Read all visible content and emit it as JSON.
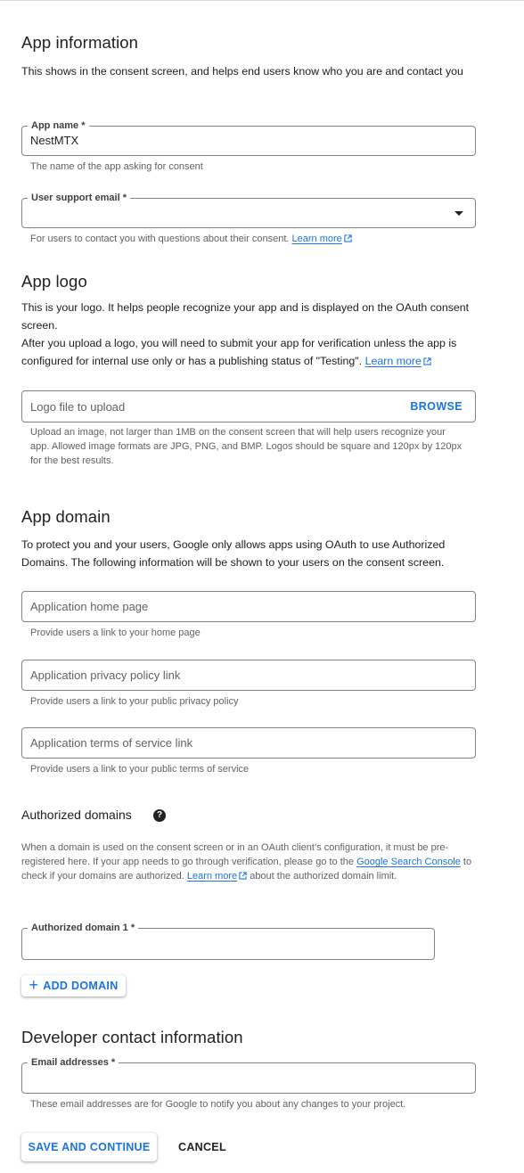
{
  "app_information": {
    "title": "App information",
    "description": "This shows in the consent screen, and helps end users know who you are and contact you",
    "app_name": {
      "label": "App name *",
      "value": "NestMTX",
      "hint": "The name of the app asking for consent"
    },
    "user_support_email": {
      "label": "User support email *",
      "selected": "",
      "hint": "For users to contact you with questions about their consent.",
      "link": "Learn more",
      "link_icon": "external-link-icon"
    }
  },
  "app_logo": {
    "title": "App logo",
    "description_1": "This is your logo. It helps people recognize your app and is displayed on the OAuth consent screen.",
    "description_2": "After you upload a logo, you will need to submit your app for verification unless the app is configured for internal use only or has a publishing status of \"Testing\".",
    "link": "Learn more",
    "logo_field": {
      "placeholder": "Logo file to upload",
      "browse_label": "BROWSE",
      "hint": "Upload an image, not larger than 1MB on the consent screen that will help users recognize your app. Allowed image formats are JPG, PNG, and BMP. Logos should be square and 120px by 120px for the best results."
    }
  },
  "app_domain": {
    "title": "App domain",
    "description": "To protect you and your users, Google only allows apps using OAuth to use Authorized Domains. The following information will be shown to your users on the consent screen.",
    "home_page": {
      "placeholder": "Application home page",
      "value": "",
      "hint": "Provide users a link to your home page"
    },
    "privacy_policy": {
      "placeholder": "Application privacy policy link",
      "value": "",
      "hint": "Provide users a link to your public privacy policy"
    },
    "terms_of_service": {
      "placeholder": "Application terms of service link",
      "value": "",
      "hint": "Provide users a link to your public terms of service"
    }
  },
  "authorized_domains": {
    "title": "Authorized domains",
    "help_icon": "help-circle-icon",
    "help_glyph": "?",
    "text_1": "When a domain is used on the consent screen or in an OAuth client’s configuration, it must be pre-registered here. If your app needs to go through verification, please go to the ",
    "search_console_link": "Google Search Console",
    "text_2": " to check if your domains are authorized. ",
    "learn_more_link": "Learn more",
    "text_3": " about the authorized domain limit.",
    "domain_1": {
      "label": "Authorized domain 1 *",
      "value": ""
    },
    "add_domain_icon": "+",
    "add_domain_label": "ADD DOMAIN"
  },
  "developer_contact": {
    "title": "Developer contact information",
    "email": {
      "label": "Email addresses *",
      "value": "",
      "hint": "These email addresses are for Google to notify you about any changes to your project."
    }
  },
  "actions": {
    "save_label": "SAVE AND CONTINUE",
    "cancel_label": "CANCEL"
  },
  "colors": {
    "accent": "#1a73e8",
    "text": "#202124",
    "secondary_text": "#5f6368",
    "border": "#80868b"
  }
}
